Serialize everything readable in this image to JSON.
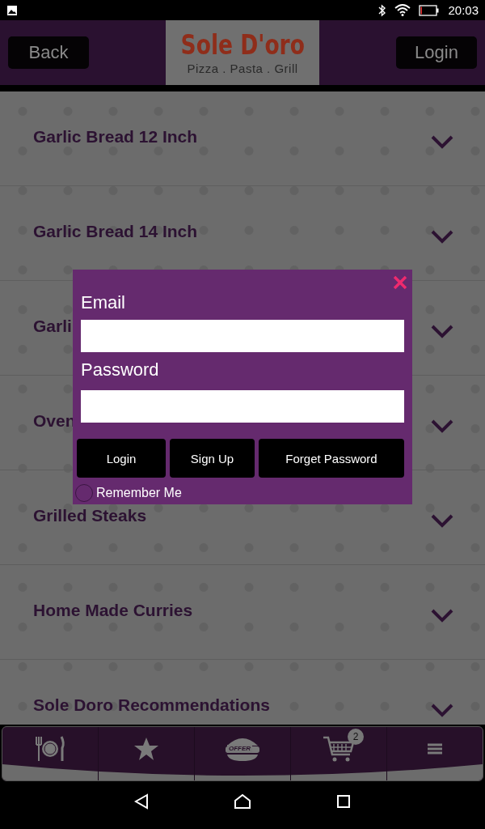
{
  "status_bar": {
    "time": "20:03"
  },
  "header": {
    "back": "Back",
    "logo_title": "Sole D'oro",
    "logo_subtitle": "Pizza . Pasta . Grill",
    "login": "Login"
  },
  "menu": [
    {
      "title": "Garlic Bread 12 Inch"
    },
    {
      "title": "Garlic Bread 14 Inch"
    },
    {
      "title": "Garli"
    },
    {
      "title": "Oven"
    },
    {
      "title": "Grilled Steaks"
    },
    {
      "title": "Home Made Curries"
    },
    {
      "title": "Sole Doro Recommendations"
    }
  ],
  "dialog": {
    "email_label": "Email",
    "password_label": "Password",
    "buttons": [
      "Login",
      "Sign Up",
      "Forget Password"
    ],
    "remember": {
      "label": "Remember Me",
      "checked": false
    }
  },
  "bottom_nav": {
    "offer_label": "OFFER",
    "cart_count": "2"
  }
}
